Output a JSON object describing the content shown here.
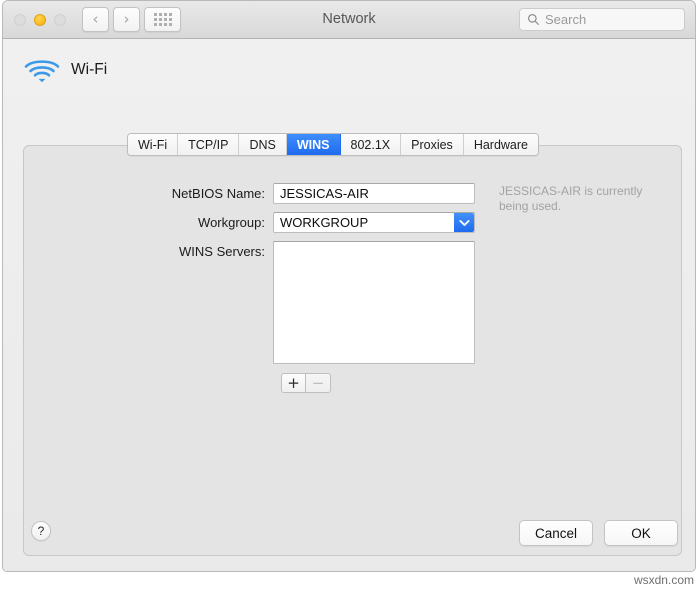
{
  "window": {
    "title": "Network",
    "traffic_lights": [
      {
        "name": "close",
        "state": "disabled"
      },
      {
        "name": "minimize",
        "state": "enabled",
        "color": "#fcbc21"
      },
      {
        "name": "zoom",
        "state": "disabled"
      }
    ],
    "nav_back": "‹",
    "nav_forward": "›",
    "show_all_label": "Show All"
  },
  "search": {
    "placeholder": "Search",
    "value": "",
    "icon": "search-icon"
  },
  "service": {
    "name": "Wi-Fi",
    "icon": "wifi-icon"
  },
  "tabs": [
    {
      "label": "Wi-Fi",
      "active": false
    },
    {
      "label": "TCP/IP",
      "active": false
    },
    {
      "label": "DNS",
      "active": false
    },
    {
      "label": "WINS",
      "active": true
    },
    {
      "label": "802.1X",
      "active": false
    },
    {
      "label": "Proxies",
      "active": false
    },
    {
      "label": "Hardware",
      "active": false
    }
  ],
  "form": {
    "netbios": {
      "label": "NetBIOS Name:",
      "value": "JESSICAS-AIR",
      "placeholder": ""
    },
    "workgroup": {
      "label": "Workgroup:",
      "value": "WORKGROUP",
      "placeholder": "",
      "dropdown_icon": "chevron-down-icon"
    },
    "wins_servers": {
      "label": "WINS Servers:",
      "items": [],
      "add_label": "+",
      "remove_label": "−",
      "remove_enabled": false
    },
    "helper_text": "JESSICAS-AIR is currently being used."
  },
  "footer": {
    "help_label": "?",
    "cancel_label": "Cancel",
    "ok_label": "OK"
  },
  "watermark": "wsxdn.com",
  "colors": {
    "accent_blue": "#1f6bef",
    "window_bg": "#ececec",
    "panel_bg": "#e4e4e4",
    "amber": "#fcbc21"
  }
}
